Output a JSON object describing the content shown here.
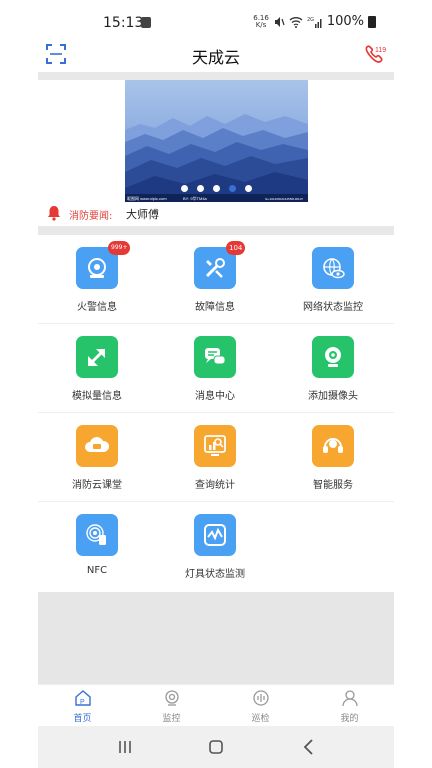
{
  "status_bar": {
    "time": "15:13",
    "net_speed_value": "6.16",
    "net_speed_unit": "K/s",
    "battery": "100%"
  },
  "header": {
    "title": "天成云",
    "scan_icon": "scan-icon",
    "fire_phone_icon": "phone-119-icon",
    "fire_phone_text": "119"
  },
  "banner": {
    "slide_count": 5,
    "active_slide": 4,
    "watermark_left": "昵图网 www.nipic.com",
    "watermark_mid": "BY: 9华TM4a",
    "watermark_right": "No.20140602164556130107"
  },
  "news": {
    "label": "消防要闻:",
    "text": "大师傅"
  },
  "grid": [
    [
      {
        "label": "火警信息",
        "color": "#4aa0f2",
        "icon": "fire-alarm-icon",
        "badge": "999+"
      },
      {
        "label": "故障信息",
        "color": "#4aa0f2",
        "icon": "tools-icon",
        "badge": "104"
      },
      {
        "label": "网络状态监控",
        "color": "#4aa0f2",
        "icon": "network-eye-icon",
        "badge": null
      }
    ],
    [
      {
        "label": "模拟量信息",
        "color": "#27c36a",
        "icon": "arrows-icon",
        "badge": null
      },
      {
        "label": "消息中心",
        "color": "#27c36a",
        "icon": "chat-icon",
        "badge": null
      },
      {
        "label": "添加摄像头",
        "color": "#27c36a",
        "icon": "webcam-icon",
        "badge": null
      }
    ],
    [
      {
        "label": "消防云课堂",
        "color": "#f7a630",
        "icon": "cloud-class-icon",
        "badge": null
      },
      {
        "label": "查询统计",
        "color": "#f7a630",
        "icon": "stats-search-icon",
        "badge": null
      },
      {
        "label": "智能服务",
        "color": "#f7a630",
        "icon": "headset-icon",
        "badge": null
      }
    ],
    [
      {
        "label": "NFC",
        "color": "#4aa0f2",
        "icon": "nfc-icon",
        "badge": null
      },
      {
        "label": "灯具状态监测",
        "color": "#4aa0f2",
        "icon": "lamp-monitor-icon",
        "badge": null
      }
    ]
  ],
  "bottom_nav": [
    {
      "label": "首页",
      "icon": "home-icon",
      "active": true
    },
    {
      "label": "监控",
      "icon": "camera-icon",
      "active": false
    },
    {
      "label": "巡检",
      "icon": "patrol-icon",
      "active": false
    },
    {
      "label": "我的",
      "icon": "user-icon",
      "active": false
    }
  ],
  "colors": {
    "accent": "#3a6fd6",
    "alert_red": "#e2433c",
    "tile_blue": "#4aa0f2",
    "tile_green": "#27c36a",
    "tile_orange": "#f7a630"
  }
}
